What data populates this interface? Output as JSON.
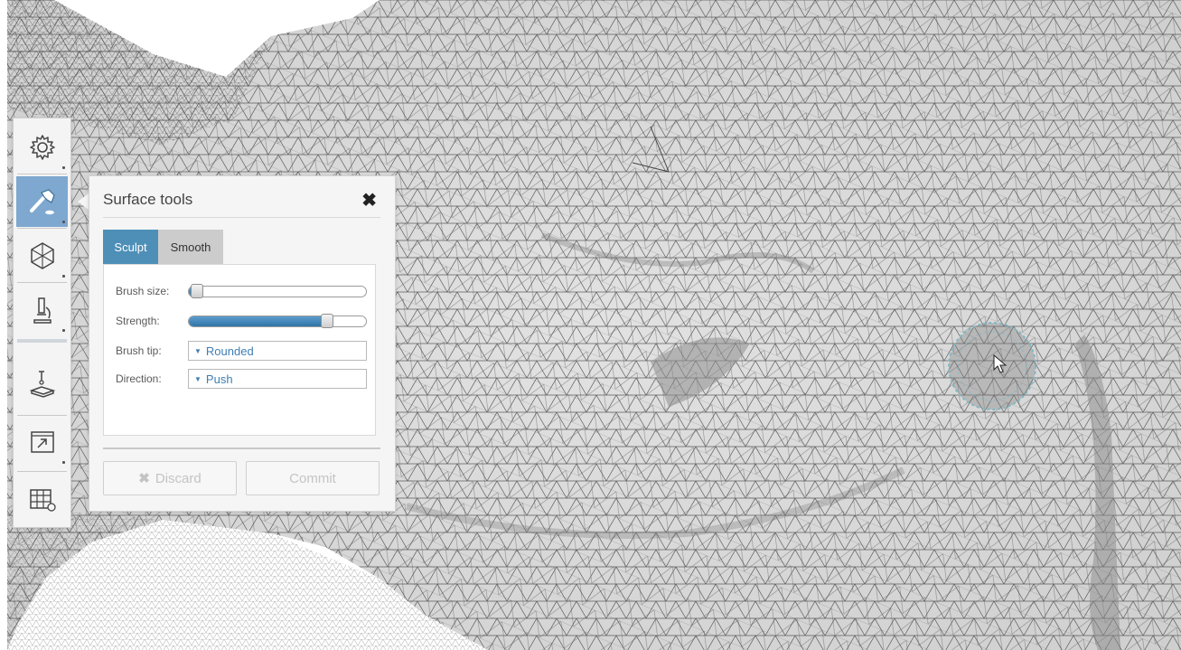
{
  "toolbar": {
    "items": [
      {
        "icon": "gear-icon"
      },
      {
        "icon": "hammer-icon",
        "active": true
      },
      {
        "icon": "hexagon-mesh-icon"
      },
      {
        "icon": "microscope-icon"
      },
      {
        "icon": "probe-stand-icon"
      },
      {
        "icon": "export-window-icon"
      },
      {
        "icon": "table-settings-icon"
      }
    ]
  },
  "dialog": {
    "title": "Surface tools",
    "close_label": "✖",
    "tabs": [
      {
        "label": "Sculpt",
        "active": true
      },
      {
        "label": "Smooth",
        "active": false
      }
    ],
    "brush_size": {
      "label": "Brush size:",
      "value": 0.05
    },
    "strength": {
      "label": "Strength:",
      "value": 0.78
    },
    "brush_tip": {
      "label": "Brush tip:",
      "value": "Rounded"
    },
    "direction": {
      "label": "Direction:",
      "value": "Push"
    },
    "discard_icon": "✖",
    "discard_label": "Discard",
    "commit_label": "Commit"
  },
  "colors": {
    "accent": "#4e8fb8",
    "toolbar_active": "#7ea8cf",
    "mesh_surface": "#d9d9d9",
    "mesh_lines": "#4a4a4a",
    "brush_cursor": "#7fb8c4"
  }
}
